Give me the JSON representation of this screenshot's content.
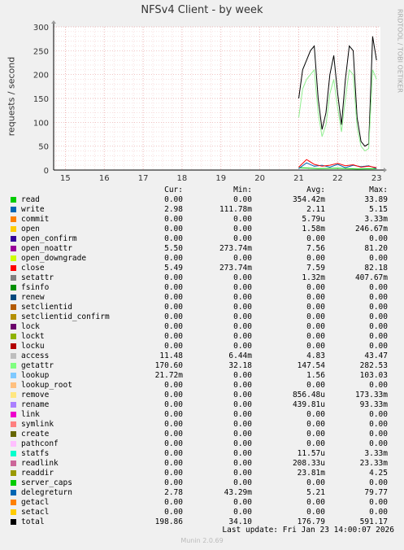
{
  "chart_data": {
    "type": "line",
    "title": "NFSv4 Client - by week",
    "ylabel": "requests / second",
    "ylim": [
      0,
      300
    ],
    "yticks": [
      "0",
      "50",
      "100",
      "150",
      "200",
      "250",
      "300"
    ],
    "xticks": [
      "15",
      "16",
      "17",
      "18",
      "19",
      "20",
      "21",
      "22",
      "23"
    ],
    "grid": true,
    "series": [
      {
        "name": "total",
        "color": "#000000",
        "x": [
          21.0,
          21.1,
          21.2,
          21.3,
          21.4,
          21.5,
          21.6,
          21.7,
          21.8,
          21.9,
          22.0,
          22.1,
          22.2,
          22.3,
          22.4,
          22.5,
          22.6,
          22.7,
          22.8,
          22.9,
          23.0
        ],
        "values": [
          150,
          210,
          230,
          250,
          260,
          150,
          85,
          120,
          200,
          240,
          160,
          95,
          190,
          260,
          250,
          110,
          60,
          50,
          55,
          280,
          230
        ]
      },
      {
        "name": "getattr",
        "color": "#90ee90",
        "x": [
          21.0,
          21.1,
          21.2,
          21.3,
          21.4,
          21.5,
          21.6,
          21.7,
          21.8,
          21.9,
          22.0,
          22.1,
          22.2,
          22.3,
          22.4,
          22.5,
          22.6,
          22.7,
          22.8,
          22.9,
          23.0
        ],
        "values": [
          110,
          170,
          190,
          200,
          210,
          120,
          70,
          95,
          160,
          190,
          130,
          80,
          150,
          210,
          200,
          90,
          50,
          40,
          45,
          210,
          190
        ]
      },
      {
        "name": "read",
        "color": "#00cc00",
        "x": [
          21.0,
          21.5,
          22.0,
          22.5,
          23.0
        ],
        "values": [
          5,
          3,
          4,
          2,
          3
        ]
      },
      {
        "name": "write",
        "color": "#0066b3",
        "x": [
          21.0,
          21.2,
          21.4,
          21.6,
          21.8,
          22.0,
          22.2,
          22.4,
          22.6,
          22.8,
          23.0
        ],
        "values": [
          3,
          15,
          8,
          10,
          6,
          12,
          5,
          10,
          7,
          9,
          3
        ]
      },
      {
        "name": "close",
        "color": "#ff0000",
        "x": [
          21.0,
          21.2,
          21.4,
          21.6,
          21.8,
          22.0,
          22.2,
          22.4,
          22.6,
          22.8,
          23.0
        ],
        "values": [
          6,
          22,
          12,
          8,
          10,
          14,
          9,
          11,
          6,
          8,
          5
        ]
      }
    ]
  },
  "legend_header": {
    "cur": "Cur:",
    "min": "Min:",
    "avg": "Avg:",
    "max": "Max:"
  },
  "legend": [
    {
      "name": "read",
      "color": "#00cc00",
      "cur": "0.00",
      "min": "0.00",
      "avg": "354.42m",
      "max": "33.89"
    },
    {
      "name": "write",
      "color": "#0066b3",
      "cur": "2.98",
      "min": "111.78m",
      "avg": "2.11",
      "max": "5.15"
    },
    {
      "name": "commit",
      "color": "#ff8000",
      "cur": "0.00",
      "min": "0.00",
      "avg": "5.79u",
      "max": "3.33m"
    },
    {
      "name": "open",
      "color": "#ffcc00",
      "cur": "0.00",
      "min": "0.00",
      "avg": "1.58m",
      "max": "246.67m"
    },
    {
      "name": "open_confirm",
      "color": "#330099",
      "cur": "0.00",
      "min": "0.00",
      "avg": "0.00",
      "max": "0.00"
    },
    {
      "name": "open_noattr",
      "color": "#990099",
      "cur": "5.50",
      "min": "273.74m",
      "avg": "7.56",
      "max": "81.20"
    },
    {
      "name": "open_downgrade",
      "color": "#ccff00",
      "cur": "0.00",
      "min": "0.00",
      "avg": "0.00",
      "max": "0.00"
    },
    {
      "name": "close",
      "color": "#ff0000",
      "cur": "5.49",
      "min": "273.74m",
      "avg": "7.59",
      "max": "82.18"
    },
    {
      "name": "setattr",
      "color": "#808080",
      "cur": "0.00",
      "min": "0.00",
      "avg": "1.32m",
      "max": "407.67m"
    },
    {
      "name": "fsinfo",
      "color": "#008f00",
      "cur": "0.00",
      "min": "0.00",
      "avg": "0.00",
      "max": "0.00"
    },
    {
      "name": "renew",
      "color": "#00487d",
      "cur": "0.00",
      "min": "0.00",
      "avg": "0.00",
      "max": "0.00"
    },
    {
      "name": "setclientid",
      "color": "#b35a00",
      "cur": "0.00",
      "min": "0.00",
      "avg": "0.00",
      "max": "0.00"
    },
    {
      "name": "setclientid_confirm",
      "color": "#b38f00",
      "cur": "0.00",
      "min": "0.00",
      "avg": "0.00",
      "max": "0.00"
    },
    {
      "name": "lock",
      "color": "#6b006b",
      "cur": "0.00",
      "min": "0.00",
      "avg": "0.00",
      "max": "0.00"
    },
    {
      "name": "lockt",
      "color": "#8fb300",
      "cur": "0.00",
      "min": "0.00",
      "avg": "0.00",
      "max": "0.00"
    },
    {
      "name": "locku",
      "color": "#b30000",
      "cur": "0.00",
      "min": "0.00",
      "avg": "0.00",
      "max": "0.00"
    },
    {
      "name": "access",
      "color": "#bebebe",
      "cur": "11.48",
      "min": "6.44m",
      "avg": "4.83",
      "max": "43.47"
    },
    {
      "name": "getattr",
      "color": "#80ff80",
      "cur": "170.60",
      "min": "32.18",
      "avg": "147.54",
      "max": "282.53"
    },
    {
      "name": "lookup",
      "color": "#80c9ff",
      "cur": "21.72m",
      "min": "0.00",
      "avg": "1.56",
      "max": "103.03"
    },
    {
      "name": "lookup_root",
      "color": "#ffc080",
      "cur": "0.00",
      "min": "0.00",
      "avg": "0.00",
      "max": "0.00"
    },
    {
      "name": "remove",
      "color": "#ffe680",
      "cur": "0.00",
      "min": "0.00",
      "avg": "856.48u",
      "max": "173.33m"
    },
    {
      "name": "rename",
      "color": "#aa80ff",
      "cur": "0.00",
      "min": "0.00",
      "avg": "439.81u",
      "max": "93.33m"
    },
    {
      "name": "link",
      "color": "#ee00cc",
      "cur": "0.00",
      "min": "0.00",
      "avg": "0.00",
      "max": "0.00"
    },
    {
      "name": "symlink",
      "color": "#ff8080",
      "cur": "0.00",
      "min": "0.00",
      "avg": "0.00",
      "max": "0.00"
    },
    {
      "name": "create",
      "color": "#666600",
      "cur": "0.00",
      "min": "0.00",
      "avg": "0.00",
      "max": "0.00"
    },
    {
      "name": "pathconf",
      "color": "#ffbfff",
      "cur": "0.00",
      "min": "0.00",
      "avg": "0.00",
      "max": "0.00"
    },
    {
      "name": "statfs",
      "color": "#00ffcc",
      "cur": "0.00",
      "min": "0.00",
      "avg": "11.57u",
      "max": "3.33m"
    },
    {
      "name": "readlink",
      "color": "#cc6699",
      "cur": "0.00",
      "min": "0.00",
      "avg": "208.33u",
      "max": "23.33m"
    },
    {
      "name": "readdir",
      "color": "#999900",
      "cur": "0.00",
      "min": "0.00",
      "avg": "23.81m",
      "max": "4.25"
    },
    {
      "name": "server_caps",
      "color": "#00cc00",
      "cur": "0.00",
      "min": "0.00",
      "avg": "0.00",
      "max": "0.00"
    },
    {
      "name": "delegreturn",
      "color": "#0066b3",
      "cur": "2.78",
      "min": "43.29m",
      "avg": "5.21",
      "max": "79.77"
    },
    {
      "name": "getacl",
      "color": "#ff8000",
      "cur": "0.00",
      "min": "0.00",
      "avg": "0.00",
      "max": "0.00"
    },
    {
      "name": "setacl",
      "color": "#ffcc00",
      "cur": "0.00",
      "min": "0.00",
      "avg": "0.00",
      "max": "0.00"
    },
    {
      "name": "total",
      "color": "#000000",
      "cur": "198.86",
      "min": "34.10",
      "avg": "176.79",
      "max": "591.17"
    }
  ],
  "last_update": "Last update: Fri Jan 23 14:00:07 2026",
  "watermark": "RRDTOOL / TOBI OETIKER",
  "footer": "Munin 2.0.69"
}
